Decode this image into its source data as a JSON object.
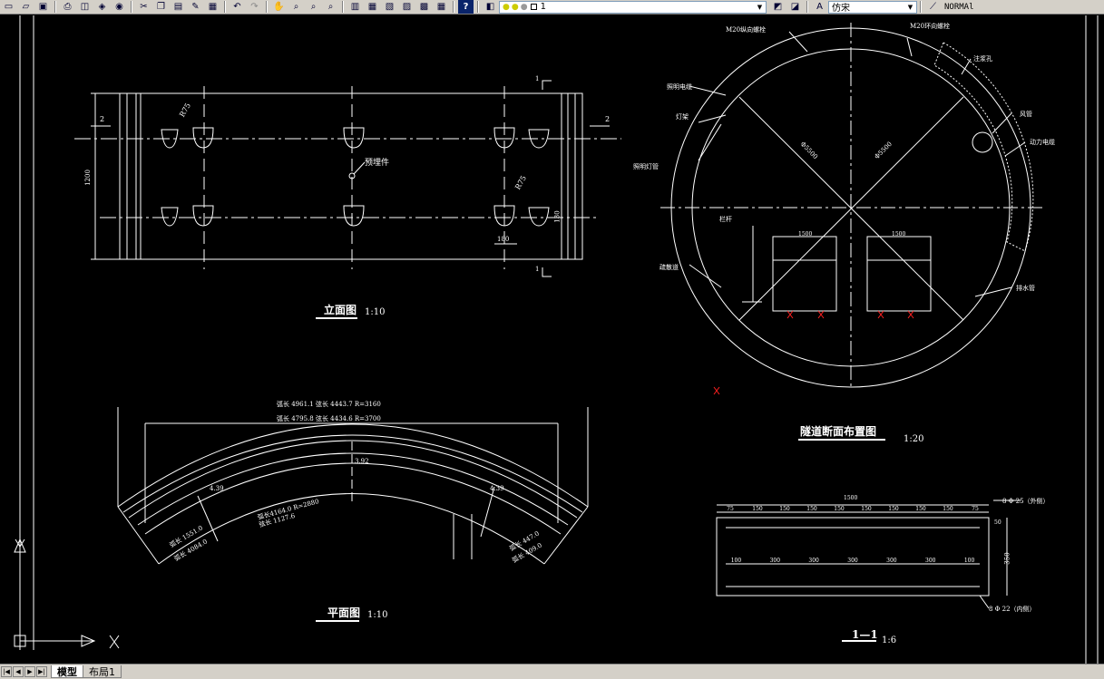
{
  "toolbar": {
    "icons": [
      "new-icon",
      "open-icon",
      "save-icon",
      "print-icon",
      "preview-icon",
      "publish-icon",
      "3d-orbit-icon",
      "cut-icon",
      "copy-icon",
      "paste-icon",
      "match-properties-icon",
      "block-editor-icon",
      "undo-icon",
      "redo-icon",
      "pan-icon",
      "zoom-realtime-icon",
      "zoom-window-icon",
      "zoom-previous-icon",
      "properties-icon",
      "design-center-icon",
      "tool-palettes-icon",
      "sheetset-icon",
      "markup-icon",
      "calculator-icon",
      "help-icon"
    ],
    "layer_value": "1",
    "layer_state_icons": [
      "bulb-icon",
      "sun-icon",
      "lock-icon",
      "color-square-icon"
    ],
    "text_style": "仿宋",
    "dim_style": "NORMAl"
  },
  "drawing": {
    "elevation": {
      "title": "立面图",
      "scale": "1:10",
      "section_marks": [
        "1",
        "1",
        "2",
        "2"
      ],
      "radius_labels": [
        "R75",
        "R75"
      ],
      "embed_label": "预埋件",
      "height_label": "1200",
      "slot_dims": [
        "180",
        "130"
      ]
    },
    "plan": {
      "title": "平面图",
      "scale": "1:10",
      "arc_lines": [
        "弧长 4961.1  弦长 4443.7  R=3160",
        "弧长 4795.8  弦长 4434.6  R=3700"
      ],
      "inner_arc_lines": [
        "弧长4164.0  R=2880",
        "弦长 1127.6"
      ],
      "angles": [
        "4.39",
        "4.39",
        "3.92"
      ],
      "end_labels": [
        "弧长 1551.0",
        "弧长 4084.0"
      ],
      "side_labels": [
        "弧长4164.0 R=2880",
        "弦长 1127.6",
        "弧长 447.0",
        "弧长 409.0"
      ]
    },
    "section": {
      "title": "隧道断面布置图",
      "scale": "1:20",
      "labels": [
        "M20纵向螺栓",
        "M20环向螺栓",
        "注浆孔",
        "照明电缆",
        "灯架",
        "照明灯管",
        "风管",
        "动力电缆",
        "栏杆",
        "疏散道",
        "排水管"
      ],
      "diameters": [
        "Φ5500",
        "Φ5500"
      ],
      "box_dims": [
        "1500",
        "1500"
      ]
    },
    "detail": {
      "title": "1—1",
      "scale": "1:6",
      "total": "1500",
      "top_spacing": [
        "75",
        "150",
        "150",
        "150",
        "150",
        "150",
        "150",
        "150",
        "150",
        "75"
      ],
      "bottom_spacing": [
        "100",
        "300",
        "300",
        "300",
        "300",
        "300",
        "100"
      ],
      "rebar_top": "8 Φ 25（外侧）",
      "rebar_bottom": "8 Φ 22（内侧）",
      "side_dims": [
        "50",
        "350"
      ]
    }
  },
  "tabs": {
    "model": "模型",
    "layout1": "布局1"
  },
  "colors": {
    "background": "#000000",
    "linework": "#ffffff",
    "marker": "#ff2020",
    "toolbar": "#d4d0c8"
  }
}
